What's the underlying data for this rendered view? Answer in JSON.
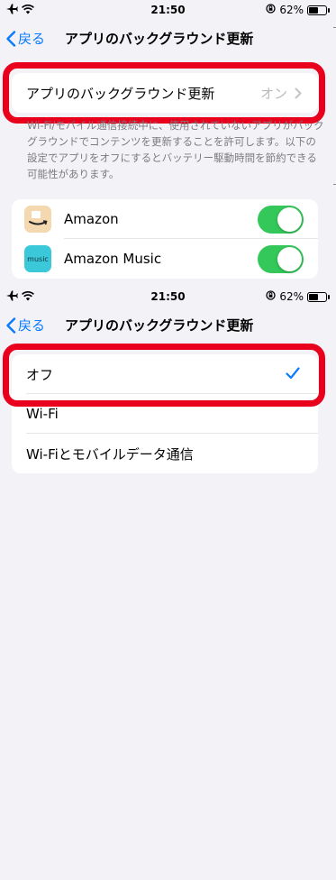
{
  "status_bar": {
    "time": "21:50",
    "battery": "62%",
    "battery_fraction": 0.62
  },
  "nav": {
    "back_label": "戻る",
    "title": "アプリのバックグラウンド更新"
  },
  "screen1": {
    "setting_row": {
      "label": "アプリのバックグラウンド更新",
      "value": "オン"
    },
    "description": "Wi-Fi/モバイル通信接続中に、使用されていないアプリがバックグラウンドでコンテンツを更新することを許可します。以下の設定でアプリをオフにするとバッテリー駆動時間を節約できる可能性があります。",
    "apps": [
      {
        "name": "Amazon",
        "enabled": true,
        "icon": "amazon-app-icon"
      },
      {
        "name": "Amazon Music",
        "enabled": true,
        "icon": "amazon-music-app-icon",
        "icon_text": "music"
      }
    ]
  },
  "screen2": {
    "options": [
      {
        "label": "オフ",
        "selected": true
      },
      {
        "label": "Wi-Fi",
        "selected": false
      },
      {
        "label": "Wi-Fiとモバイルデータ通信",
        "selected": false
      }
    ]
  },
  "colors": {
    "accent": "#0a7aff",
    "toggle_on": "#34c759",
    "highlight": "#e8001c",
    "background": "#f2f2f7"
  }
}
